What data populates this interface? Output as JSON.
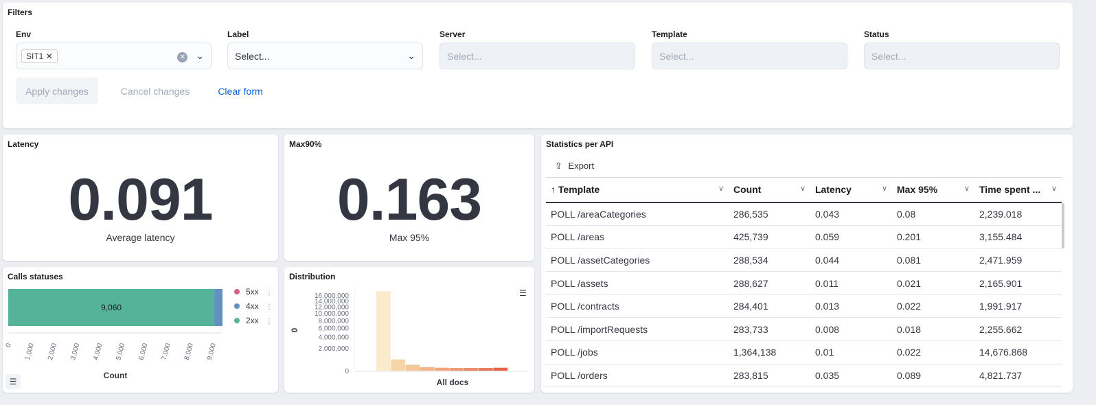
{
  "filters": {
    "title": "Filters",
    "fields": [
      {
        "label": "Env",
        "chip": "SIT1",
        "placeholder": ""
      },
      {
        "label": "Label",
        "placeholder": "Select..."
      },
      {
        "label": "Server",
        "placeholder": "Select..."
      },
      {
        "label": "Template",
        "placeholder": "Select..."
      },
      {
        "label": "Status",
        "placeholder": "Select..."
      }
    ],
    "apply": "Apply changes",
    "cancel": "Cancel changes",
    "clear": "Clear form"
  },
  "latency": {
    "title": "Latency",
    "value": "0.091",
    "label": "Average latency"
  },
  "max90": {
    "title": "Max90%",
    "value": "0.163",
    "label": "Max 95%"
  },
  "stats": {
    "title": "Statistics per API",
    "export": "Export",
    "columns": [
      "Template",
      "Count",
      "Latency",
      "Max 95%",
      "Time spent ..."
    ],
    "rows": [
      [
        "POLL /areaCategories",
        "286,535",
        "0.043",
        "0.08",
        "2,239.018"
      ],
      [
        "POLL /areas",
        "425,739",
        "0.059",
        "0.201",
        "3,155.484"
      ],
      [
        "POLL /assetCategories",
        "288,534",
        "0.044",
        "0.081",
        "2,471.959"
      ],
      [
        "POLL /assets",
        "288,627",
        "0.011",
        "0.021",
        "2,165.901"
      ],
      [
        "POLL /contracts",
        "284,401",
        "0.013",
        "0.022",
        "1,991.917"
      ],
      [
        "POLL /importRequests",
        "283,733",
        "0.008",
        "0.018",
        "2,255.662"
      ],
      [
        "POLL /jobs",
        "1,364,138",
        "0.01",
        "0.022",
        "14,676.868"
      ],
      [
        "POLL /orders",
        "283,815",
        "0.035",
        "0.089",
        "4,821.737"
      ]
    ]
  },
  "chart_data": [
    {
      "title": "Calls statuses",
      "type": "bar",
      "orientation": "horizontal-stacked",
      "xlabel": "Count",
      "ticks": [
        "0",
        "1,000",
        "2,000",
        "3,000",
        "4,000",
        "5,000",
        "6,000",
        "7,000",
        "8,000",
        "9,000"
      ],
      "xlim": [
        0,
        9420
      ],
      "series": [
        {
          "name": "2xx",
          "value": 9060,
          "label": "9,060",
          "color": "#54b399"
        },
        {
          "name": "4xx",
          "value": 360,
          "color": "#6092c0"
        },
        {
          "name": "5xx",
          "value": 0,
          "color": "#d36086"
        }
      ],
      "legend": "right"
    },
    {
      "title": "Distribution",
      "type": "bar",
      "xlabel": "All docs",
      "ylabel": "0",
      "yscale": "sqrt-like",
      "ticks": [
        "0",
        "2,000,000",
        "4,000,000",
        "6,000,000",
        "8,000,000",
        "10,000,000",
        "12,000,000",
        "14,000,000",
        "16,000,000"
      ],
      "values": [
        17400000,
        600000,
        200000,
        80000,
        60000,
        50000,
        50000,
        50000,
        60000
      ],
      "colors": [
        "#f9ebcb",
        "#f6d6a9",
        "#f4c79a",
        "#f2b489",
        "#efa67e",
        "#ec9672",
        "#e98665",
        "#e77658",
        "#e5654b"
      ]
    }
  ]
}
